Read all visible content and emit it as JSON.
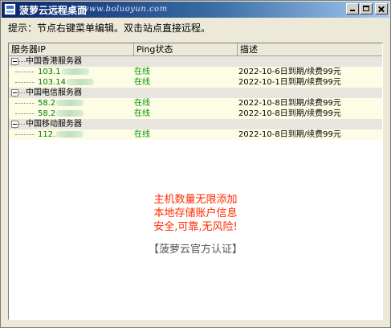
{
  "window": {
    "title": "菠萝云远程桌面",
    "url": "www.boluoyun.com"
  },
  "hint": "提示：节点右键菜单编辑。双击站点直接远程。",
  "columns": {
    "ip": "服务器IP",
    "ping": "Ping状态",
    "desc": "描述"
  },
  "groups": [
    {
      "name": "中国香港服务器",
      "servers": [
        {
          "ip": "103.1",
          "ping": "在线",
          "desc": "2022-10-6日到期/续费99元"
        },
        {
          "ip": "103.14",
          "ping": "在线",
          "desc": "2022-10-1日到期/续费99元"
        }
      ]
    },
    {
      "name": "中国电信服务器",
      "servers": [
        {
          "ip": "58.2",
          "ping": "在线",
          "desc": "2022-10-8日到期/续费99元"
        },
        {
          "ip": "58.2",
          "ping": "在线",
          "desc": "2022-10-8日到期/续费99元"
        }
      ]
    },
    {
      "name": "中国移动服务器",
      "servers": [
        {
          "ip": "112.",
          "ping": "在线",
          "desc": "2022-10-8日到期/续费99元"
        }
      ]
    }
  ],
  "promo": {
    "line1": "主机数量无限添加",
    "line2": "本地存储账户信息",
    "line3": "安全,可靠,无风险!"
  },
  "cert": "【菠萝云官方认证】",
  "colors": {
    "online": "#009000",
    "ip": "#007a00",
    "promo": "#ff2a00",
    "titlebar": "#0a246a"
  }
}
